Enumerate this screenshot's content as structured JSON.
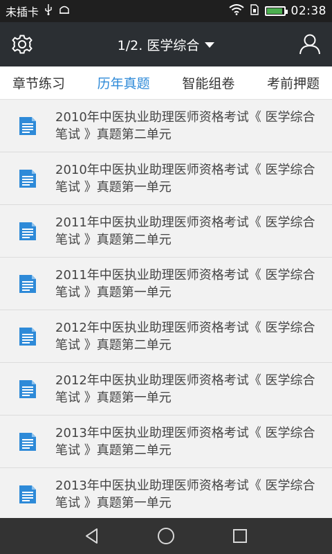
{
  "status_bar": {
    "carrier": "未插卡",
    "time": "02:38",
    "battery_level": 0.95
  },
  "header": {
    "title": "1/2. 医学综合",
    "icons": {
      "left": "settings-gear-icon",
      "right": "user-profile-icon",
      "dropdown": "caret-down-icon"
    }
  },
  "tabs": [
    {
      "label": "章节练习",
      "active": false
    },
    {
      "label": "历年真题",
      "active": true
    },
    {
      "label": "智能组卷",
      "active": false
    },
    {
      "label": "考前押题",
      "active": false
    }
  ],
  "list": {
    "items": [
      {
        "title": "2010年中医执业助理医师资格考试《 医学综合笔试 》真题第二单元"
      },
      {
        "title": "2010年中医执业助理医师资格考试《 医学综合笔试 》真题第一单元"
      },
      {
        "title": "2011年中医执业助理医师资格考试《 医学综合笔试 》真题第二单元"
      },
      {
        "title": "2011年中医执业助理医师资格考试《 医学综合笔试 》真题第一单元"
      },
      {
        "title": "2012年中医执业助理医师资格考试《 医学综合笔试 》真题第二单元"
      },
      {
        "title": "2012年中医执业助理医师资格考试《 医学综合笔试 》真题第一单元"
      },
      {
        "title": "2013年中医执业助理医师资格考试《 医学综合笔试 》真题第二单元"
      },
      {
        "title": "2013年中医执业助理医师资格考试《 医学综合笔试 》真题第一单元"
      }
    ]
  },
  "colors": {
    "accent": "#2e8ad8",
    "header_bg": "#2b2f33",
    "status_bg": "#1f1f1f",
    "battery": "#4caf50"
  }
}
